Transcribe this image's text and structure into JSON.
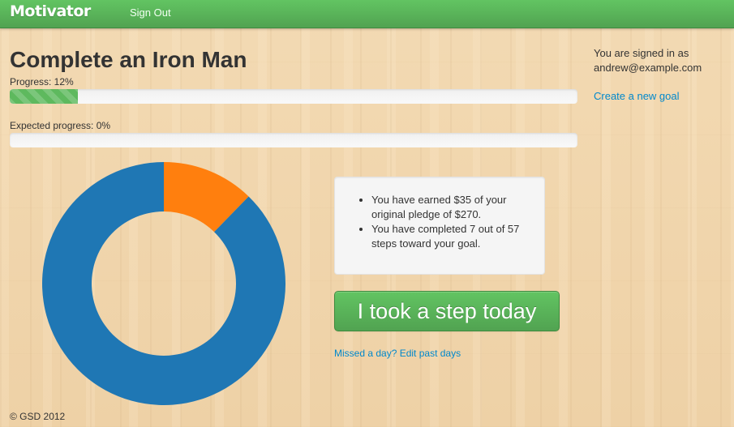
{
  "navbar": {
    "brand": "Motivator",
    "sign_out": "Sign Out",
    "color": "#5eb95e"
  },
  "goal": {
    "title": "Complete an Iron Man",
    "progress_label": "Progress: 12%",
    "progress_fraction": 0.12,
    "expected_label": "Expected progress: 0%",
    "expected_fraction": 0.0
  },
  "sidebar": {
    "signed_in_text": "You are signed in as",
    "email": "andrew@example.com",
    "create_goal": "Create a new goal"
  },
  "chart_data": {
    "type": "pie",
    "donut": true,
    "slices": [
      {
        "value": 7,
        "color": "#ff7f0e"
      },
      {
        "value": 50,
        "color": "#1f77b4"
      }
    ]
  },
  "summary": {
    "items": [
      "You have earned $35 of your original pledge of $270.",
      "You have completed 7 out of 57 steps toward your goal."
    ]
  },
  "actions": {
    "step_button": "I took a step today",
    "edit_link": "Missed a day? Edit past days"
  },
  "footer": {
    "copyright": "© GSD 2012"
  }
}
